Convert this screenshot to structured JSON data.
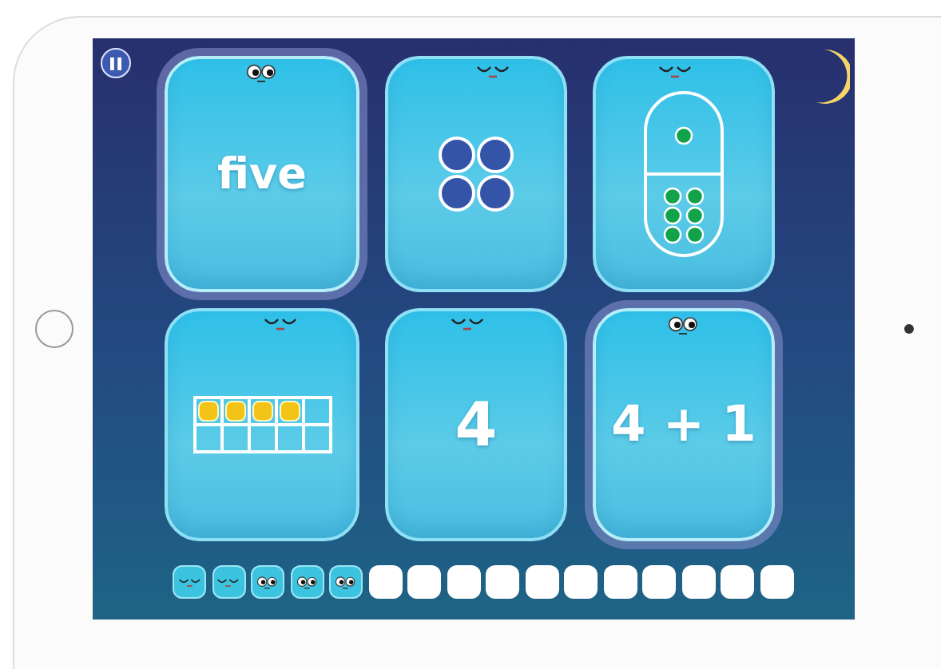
{
  "cards": [
    {
      "kind": "word",
      "text": "five",
      "selected": true
    },
    {
      "kind": "dots",
      "selected": false
    },
    {
      "kind": "domino",
      "selected": false
    },
    {
      "kind": "ten-frame",
      "selected": false,
      "cells": [
        true,
        true,
        true,
        true,
        false,
        false,
        false,
        false,
        false,
        false
      ]
    },
    {
      "kind": "numeral",
      "text": "4",
      "selected": false
    },
    {
      "kind": "expression",
      "text": "4 + 1",
      "selected": true
    }
  ],
  "progress": [
    {
      "filled": true,
      "awake": false
    },
    {
      "filled": true,
      "awake": false
    },
    {
      "filled": true,
      "awake": true
    },
    {
      "filled": true,
      "awake": true
    },
    {
      "filled": true,
      "awake": true
    },
    {
      "filled": false
    },
    {
      "filled": false
    },
    {
      "filled": false
    },
    {
      "filled": false
    },
    {
      "filled": false
    },
    {
      "filled": false
    },
    {
      "filled": false
    },
    {
      "filled": false
    },
    {
      "filled": false
    },
    {
      "filled": false
    },
    {
      "filled": false
    }
  ]
}
